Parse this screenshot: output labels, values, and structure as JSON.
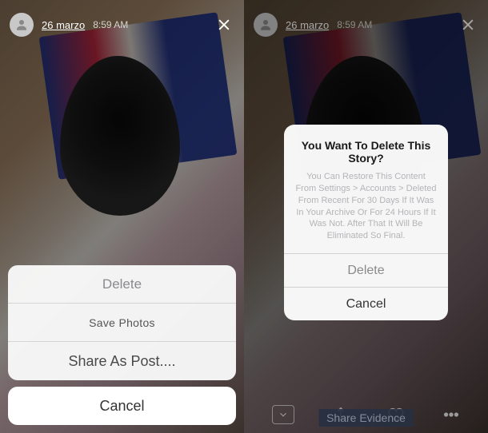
{
  "left": {
    "header": {
      "date": "26 marzo",
      "time": "8:59 AM"
    },
    "sheet": {
      "delete": "Delete",
      "save": "Save Photos",
      "share": "Share As Post....",
      "cancel": "Cancel"
    }
  },
  "right": {
    "header": {
      "date": "26 marzo",
      "time": "8:59 AM"
    },
    "alert": {
      "title": "You Want To Delete This Story?",
      "message": "You Can Restore This Content From Settings > Accounts > Deleted From Recent For 30 Days If It Was In Your Archive Or For 24 Hours If It Was Not. After That It Will Be Eliminated So Final.",
      "delete": "Delete",
      "cancel": "Cancel"
    },
    "bottombar": {
      "share_evidence": "Share Evidence"
    }
  }
}
